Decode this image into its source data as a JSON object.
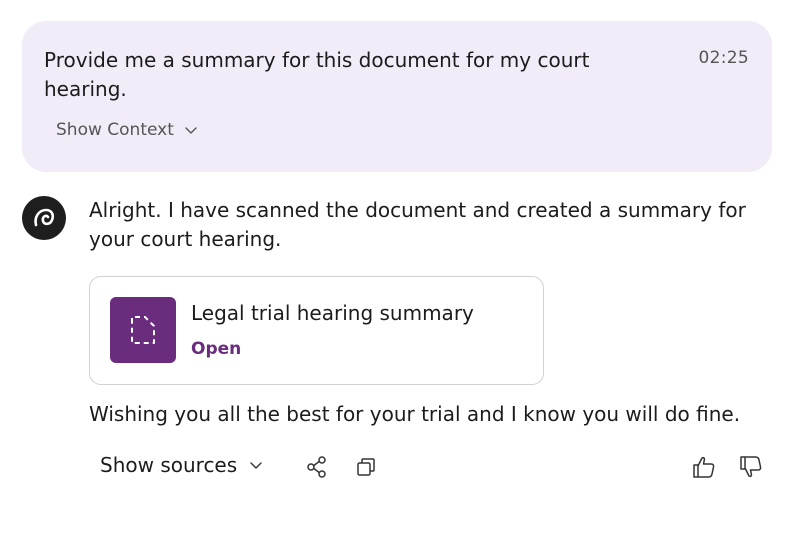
{
  "user_message": {
    "text": "Provide me a summary for this document for my court hearing.",
    "timestamp": "02:25",
    "show_context_label": "Show Context"
  },
  "assistant": {
    "avatar_icon": "copilot-logo-icon",
    "reply_text": "Alright. I have scanned the document and created a summary for your court hearing.",
    "document_card": {
      "title": "Legal trial hearing summary",
      "action_label": "Open",
      "icon": "document-dashed-icon"
    },
    "closing_text": "Wishing you all the best for your trial and I know you will do fine."
  },
  "actions": {
    "show_sources_label": "Show sources",
    "icons": [
      "share-icon",
      "copy-icon",
      "thumbs-up-icon",
      "thumbs-down-icon"
    ]
  },
  "colors": {
    "bubble_bg": "#f1ecf7",
    "accent": "#6a2c7d",
    "avatar_bg": "#1e1e1e"
  }
}
